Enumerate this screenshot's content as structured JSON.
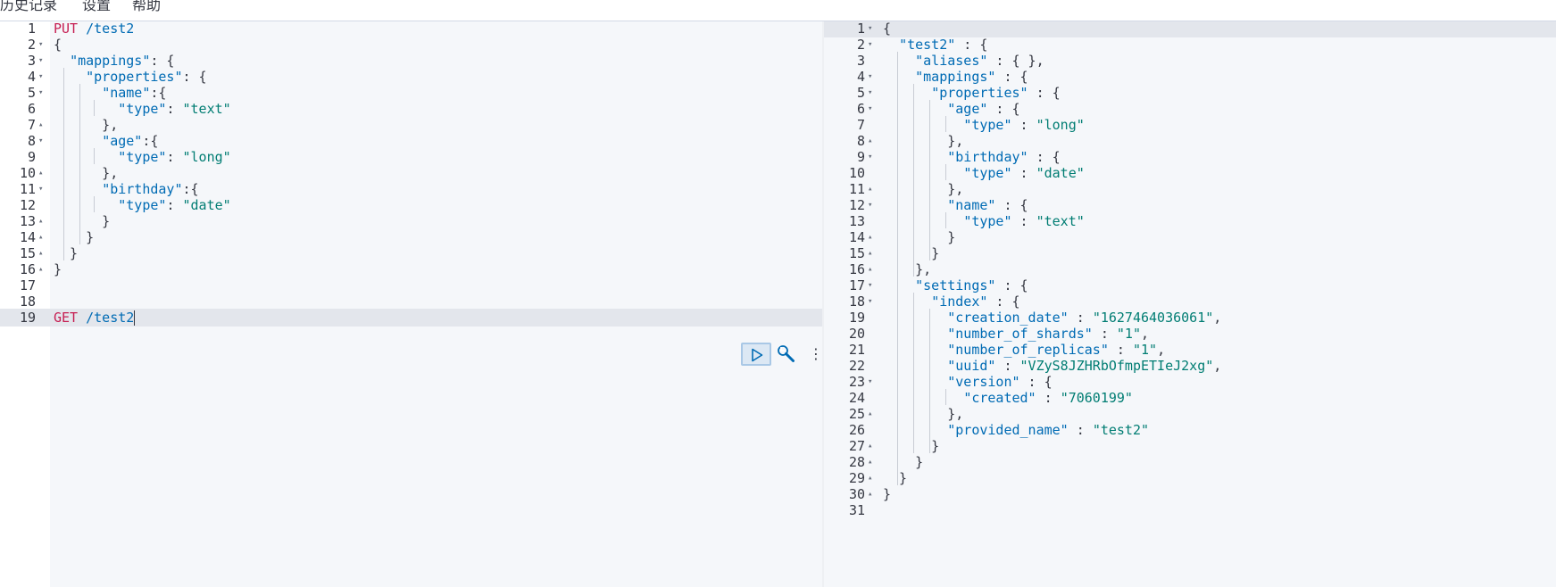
{
  "menu": {
    "history": "历史记录",
    "settings": "设置",
    "help": "帮助"
  },
  "request_editor": {
    "lines": [
      {
        "n": "1",
        "fold": "",
        "tokens": [
          {
            "c": "m",
            "t": "PUT"
          },
          {
            "c": "k",
            "t": " /test2"
          }
        ]
      },
      {
        "n": "2",
        "fold": "down",
        "tokens": [
          {
            "c": "p",
            "t": "{"
          }
        ]
      },
      {
        "n": "3",
        "fold": "down",
        "tokens": [
          {
            "c": "p",
            "t": "  "
          },
          {
            "c": "k",
            "t": "\"mappings\""
          },
          {
            "c": "p",
            "t": ": {"
          }
        ]
      },
      {
        "n": "4",
        "fold": "down",
        "tokens": [
          {
            "c": "p",
            "t": "    "
          },
          {
            "c": "k",
            "t": "\"properties\""
          },
          {
            "c": "p",
            "t": ": {"
          }
        ]
      },
      {
        "n": "5",
        "fold": "down",
        "tokens": [
          {
            "c": "p",
            "t": "      "
          },
          {
            "c": "k",
            "t": "\"name\""
          },
          {
            "c": "p",
            "t": ":{"
          }
        ]
      },
      {
        "n": "6",
        "fold": "",
        "tokens": [
          {
            "c": "p",
            "t": "        "
          },
          {
            "c": "k",
            "t": "\"type\""
          },
          {
            "c": "p",
            "t": ": "
          },
          {
            "c": "s",
            "t": "\"text\""
          }
        ]
      },
      {
        "n": "7",
        "fold": "up",
        "tokens": [
          {
            "c": "p",
            "t": "      },"
          }
        ]
      },
      {
        "n": "8",
        "fold": "down",
        "tokens": [
          {
            "c": "p",
            "t": "      "
          },
          {
            "c": "k",
            "t": "\"age\""
          },
          {
            "c": "p",
            "t": ":{"
          }
        ]
      },
      {
        "n": "9",
        "fold": "",
        "tokens": [
          {
            "c": "p",
            "t": "        "
          },
          {
            "c": "k",
            "t": "\"type\""
          },
          {
            "c": "p",
            "t": ": "
          },
          {
            "c": "s",
            "t": "\"long\""
          }
        ]
      },
      {
        "n": "10",
        "fold": "up",
        "tokens": [
          {
            "c": "p",
            "t": "      },"
          }
        ]
      },
      {
        "n": "11",
        "fold": "down",
        "tokens": [
          {
            "c": "p",
            "t": "      "
          },
          {
            "c": "k",
            "t": "\"birthday\""
          },
          {
            "c": "p",
            "t": ":{"
          }
        ]
      },
      {
        "n": "12",
        "fold": "",
        "tokens": [
          {
            "c": "p",
            "t": "        "
          },
          {
            "c": "k",
            "t": "\"type\""
          },
          {
            "c": "p",
            "t": ": "
          },
          {
            "c": "s",
            "t": "\"date\""
          }
        ]
      },
      {
        "n": "13",
        "fold": "up",
        "tokens": [
          {
            "c": "p",
            "t": "      }"
          }
        ]
      },
      {
        "n": "14",
        "fold": "up",
        "tokens": [
          {
            "c": "p",
            "t": "    }"
          }
        ]
      },
      {
        "n": "15",
        "fold": "up",
        "tokens": [
          {
            "c": "p",
            "t": "  }"
          }
        ]
      },
      {
        "n": "16",
        "fold": "up",
        "tokens": [
          {
            "c": "p",
            "t": "}"
          }
        ]
      },
      {
        "n": "17",
        "fold": "",
        "tokens": []
      },
      {
        "n": "18",
        "fold": "",
        "tokens": []
      },
      {
        "n": "19",
        "fold": "",
        "active": true,
        "tokens": [
          {
            "c": "m",
            "t": "GET"
          },
          {
            "c": "k",
            "t": " /test2"
          }
        ]
      }
    ]
  },
  "response_viewer": {
    "lines": [
      {
        "n": "1",
        "fold": "down",
        "active": true,
        "tokens": [
          {
            "c": "p",
            "t": "{"
          }
        ]
      },
      {
        "n": "2",
        "fold": "down",
        "tokens": [
          {
            "c": "p",
            "t": "  "
          },
          {
            "c": "k",
            "t": "\"test2\""
          },
          {
            "c": "p",
            "t": " : {"
          }
        ]
      },
      {
        "n": "3",
        "fold": "",
        "tokens": [
          {
            "c": "p",
            "t": "    "
          },
          {
            "c": "k",
            "t": "\"aliases\""
          },
          {
            "c": "p",
            "t": " : { },"
          }
        ]
      },
      {
        "n": "4",
        "fold": "down",
        "tokens": [
          {
            "c": "p",
            "t": "    "
          },
          {
            "c": "k",
            "t": "\"mappings\""
          },
          {
            "c": "p",
            "t": " : {"
          }
        ]
      },
      {
        "n": "5",
        "fold": "down",
        "tokens": [
          {
            "c": "p",
            "t": "      "
          },
          {
            "c": "k",
            "t": "\"properties\""
          },
          {
            "c": "p",
            "t": " : {"
          }
        ]
      },
      {
        "n": "6",
        "fold": "down",
        "tokens": [
          {
            "c": "p",
            "t": "        "
          },
          {
            "c": "k",
            "t": "\"age\""
          },
          {
            "c": "p",
            "t": " : {"
          }
        ]
      },
      {
        "n": "7",
        "fold": "",
        "tokens": [
          {
            "c": "p",
            "t": "          "
          },
          {
            "c": "k",
            "t": "\"type\""
          },
          {
            "c": "p",
            "t": " : "
          },
          {
            "c": "s",
            "t": "\"long\""
          }
        ]
      },
      {
        "n": "8",
        "fold": "up",
        "tokens": [
          {
            "c": "p",
            "t": "        },"
          }
        ]
      },
      {
        "n": "9",
        "fold": "down",
        "tokens": [
          {
            "c": "p",
            "t": "        "
          },
          {
            "c": "k",
            "t": "\"birthday\""
          },
          {
            "c": "p",
            "t": " : {"
          }
        ]
      },
      {
        "n": "10",
        "fold": "",
        "tokens": [
          {
            "c": "p",
            "t": "          "
          },
          {
            "c": "k",
            "t": "\"type\""
          },
          {
            "c": "p",
            "t": " : "
          },
          {
            "c": "s",
            "t": "\"date\""
          }
        ]
      },
      {
        "n": "11",
        "fold": "up",
        "tokens": [
          {
            "c": "p",
            "t": "        },"
          }
        ]
      },
      {
        "n": "12",
        "fold": "down",
        "tokens": [
          {
            "c": "p",
            "t": "        "
          },
          {
            "c": "k",
            "t": "\"name\""
          },
          {
            "c": "p",
            "t": " : {"
          }
        ]
      },
      {
        "n": "13",
        "fold": "",
        "tokens": [
          {
            "c": "p",
            "t": "          "
          },
          {
            "c": "k",
            "t": "\"type\""
          },
          {
            "c": "p",
            "t": " : "
          },
          {
            "c": "s",
            "t": "\"text\""
          }
        ]
      },
      {
        "n": "14",
        "fold": "up",
        "tokens": [
          {
            "c": "p",
            "t": "        }"
          }
        ]
      },
      {
        "n": "15",
        "fold": "up",
        "tokens": [
          {
            "c": "p",
            "t": "      }"
          }
        ]
      },
      {
        "n": "16",
        "fold": "up",
        "tokens": [
          {
            "c": "p",
            "t": "    },"
          }
        ]
      },
      {
        "n": "17",
        "fold": "down",
        "tokens": [
          {
            "c": "p",
            "t": "    "
          },
          {
            "c": "k",
            "t": "\"settings\""
          },
          {
            "c": "p",
            "t": " : {"
          }
        ]
      },
      {
        "n": "18",
        "fold": "down",
        "tokens": [
          {
            "c": "p",
            "t": "      "
          },
          {
            "c": "k",
            "t": "\"index\""
          },
          {
            "c": "p",
            "t": " : {"
          }
        ]
      },
      {
        "n": "19",
        "fold": "",
        "tokens": [
          {
            "c": "p",
            "t": "        "
          },
          {
            "c": "k",
            "t": "\"creation_date\""
          },
          {
            "c": "p",
            "t": " : "
          },
          {
            "c": "s",
            "t": "\"1627464036061\""
          },
          {
            "c": "p",
            "t": ","
          }
        ]
      },
      {
        "n": "20",
        "fold": "",
        "tokens": [
          {
            "c": "p",
            "t": "        "
          },
          {
            "c": "k",
            "t": "\"number_of_shards\""
          },
          {
            "c": "p",
            "t": " : "
          },
          {
            "c": "s",
            "t": "\"1\""
          },
          {
            "c": "p",
            "t": ","
          }
        ]
      },
      {
        "n": "21",
        "fold": "",
        "tokens": [
          {
            "c": "p",
            "t": "        "
          },
          {
            "c": "k",
            "t": "\"number_of_replicas\""
          },
          {
            "c": "p",
            "t": " : "
          },
          {
            "c": "s",
            "t": "\"1\""
          },
          {
            "c": "p",
            "t": ","
          }
        ]
      },
      {
        "n": "22",
        "fold": "",
        "tokens": [
          {
            "c": "p",
            "t": "        "
          },
          {
            "c": "k",
            "t": "\"uuid\""
          },
          {
            "c": "p",
            "t": " : "
          },
          {
            "c": "s",
            "t": "\"VZyS8JZHRbOfmpETIeJ2xg\""
          },
          {
            "c": "p",
            "t": ","
          }
        ]
      },
      {
        "n": "23",
        "fold": "down",
        "tokens": [
          {
            "c": "p",
            "t": "        "
          },
          {
            "c": "k",
            "t": "\"version\""
          },
          {
            "c": "p",
            "t": " : {"
          }
        ]
      },
      {
        "n": "24",
        "fold": "",
        "tokens": [
          {
            "c": "p",
            "t": "          "
          },
          {
            "c": "k",
            "t": "\"created\""
          },
          {
            "c": "p",
            "t": " : "
          },
          {
            "c": "s",
            "t": "\"7060199\""
          }
        ]
      },
      {
        "n": "25",
        "fold": "up",
        "tokens": [
          {
            "c": "p",
            "t": "        },"
          }
        ]
      },
      {
        "n": "26",
        "fold": "",
        "tokens": [
          {
            "c": "p",
            "t": "        "
          },
          {
            "c": "k",
            "t": "\"provided_name\""
          },
          {
            "c": "p",
            "t": " : "
          },
          {
            "c": "s",
            "t": "\"test2\""
          }
        ]
      },
      {
        "n": "27",
        "fold": "up",
        "tokens": [
          {
            "c": "p",
            "t": "      }"
          }
        ]
      },
      {
        "n": "28",
        "fold": "up",
        "tokens": [
          {
            "c": "p",
            "t": "    }"
          }
        ]
      },
      {
        "n": "29",
        "fold": "up",
        "tokens": [
          {
            "c": "p",
            "t": "  }"
          }
        ]
      },
      {
        "n": "30",
        "fold": "up",
        "tokens": [
          {
            "c": "p",
            "t": "}"
          }
        ]
      },
      {
        "n": "31",
        "fold": "",
        "tokens": []
      }
    ]
  },
  "actions": {
    "run_icon": "play-icon",
    "wrench_icon": "wrench-icon",
    "more_icon": "more-vertical-icon",
    "more_glyph": "⋮"
  },
  "colors": {
    "method": "#C61E52",
    "key": "#006BB4",
    "string": "#017D73",
    "editor_bg": "#f5f7fa",
    "active_line": "#e3e6ec"
  }
}
